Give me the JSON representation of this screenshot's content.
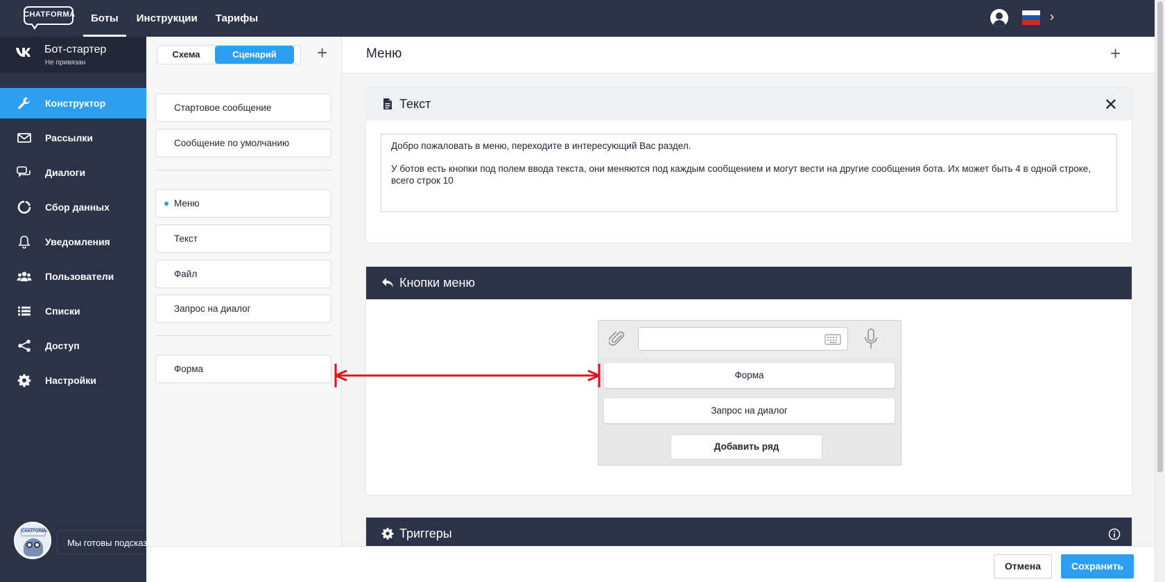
{
  "topbar": {
    "logo_text": "CHATFORMA",
    "nav": [
      {
        "label": "Боты",
        "active": true
      },
      {
        "label": "Инструкции",
        "active": false
      },
      {
        "label": "Тарифы",
        "active": false
      }
    ],
    "flag_colors": [
      "#ffffff",
      "#1c57a5",
      "#d52b1e"
    ]
  },
  "sidebar": {
    "bot_name": "Бот-стартер",
    "bot_status": "Не привязан",
    "items": [
      {
        "label": "Конструктор",
        "icon": "wrench-icon",
        "active": true
      },
      {
        "label": "Рассылки",
        "icon": "envelope-icon",
        "active": false
      },
      {
        "label": "Диалоги",
        "icon": "chat-bubbles-icon",
        "active": false
      },
      {
        "label": "Сбор данных",
        "icon": "circle-chart-icon",
        "active": false
      },
      {
        "label": "Уведомления",
        "icon": "bell-icon",
        "active": false
      },
      {
        "label": "Пользователи",
        "icon": "users-icon",
        "active": false
      },
      {
        "label": "Списки",
        "icon": "list-icon",
        "active": false
      },
      {
        "label": "Доступ",
        "icon": "share-icon",
        "active": false
      },
      {
        "label": "Настройки",
        "icon": "gear-icon",
        "active": false
      }
    ],
    "chat_tip": "Мы готовы подсказать!",
    "avatar_badge": "CHATFORMA"
  },
  "scenario": {
    "tabs": [
      "Схема",
      "Сценарий"
    ],
    "active_tab": "Сценарий",
    "group1": [
      "Стартовое сообщение",
      "Сообщение по умолчанию"
    ],
    "group2": [
      "Меню",
      "Текст",
      "Файл",
      "Запрос на диалог"
    ],
    "selected": "Меню",
    "group3": [
      "Форма"
    ]
  },
  "main": {
    "title": "Меню",
    "text_card": {
      "title": "Текст",
      "line1": "Добро пожаловать в меню, переходите в интересующий Вас раздел.",
      "line2": "У ботов есть кнопки под полем ввода текста, они меняются под каждым сообщением и могут вести на другие сообщения бота. Их может быть 4 в одной строке, всего строк 10"
    },
    "menu_card": {
      "title": "Кнопки меню",
      "buttons": [
        "Форма",
        "Запрос на диалог"
      ],
      "add_row": "Добавить ряд"
    },
    "triggers_card": {
      "title": "Триггеры"
    }
  },
  "footer": {
    "cancel": "Отмена",
    "save": "Сохранить"
  },
  "colors": {
    "accent": "#2d9ff0",
    "dark": "#2c3247",
    "arrow": "#e0141e"
  }
}
